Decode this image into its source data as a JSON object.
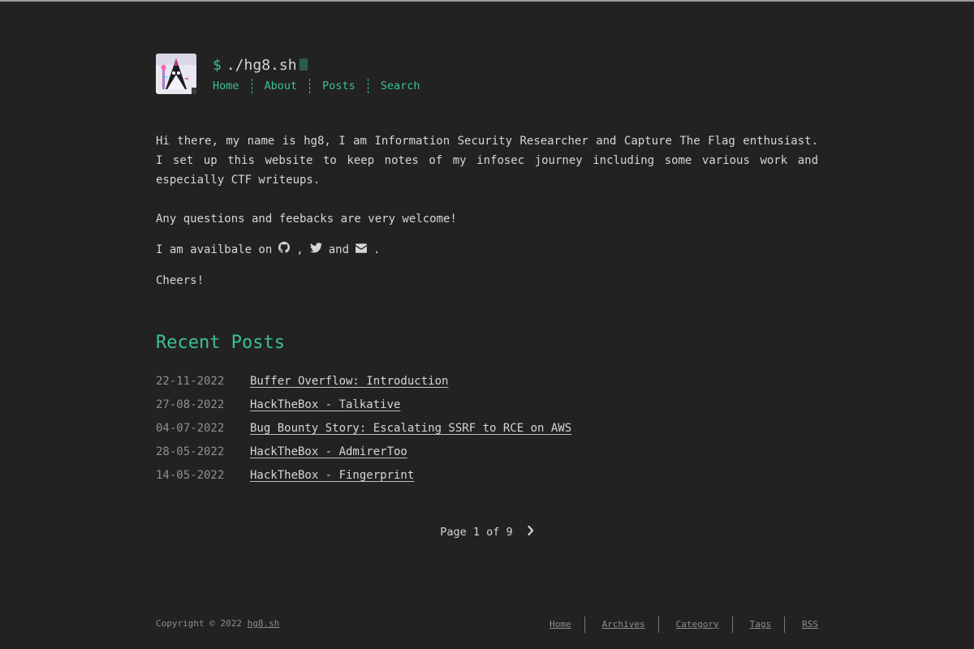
{
  "header": {
    "prompt": "$",
    "title": "./hg8.sh",
    "nav": [
      {
        "label": "Home"
      },
      {
        "label": "About"
      },
      {
        "label": "Posts"
      },
      {
        "label": "Search"
      }
    ]
  },
  "intro": {
    "paragraph1": "Hi there, my name is hg8, I am Information Security Researcher and Capture The Flag enthusiast. I set up this website to keep notes of my infosec journey including some various work and especially CTF writeups.",
    "paragraph2": "Any questions and feebacks are very welcome!",
    "available_prefix": "I am availbale on",
    "comma": ",",
    "and": "and",
    "period": ".",
    "icons": [
      "github-icon",
      "twitter-icon",
      "envelope-icon"
    ],
    "paragraph4": "Cheers!"
  },
  "recent_posts": {
    "title": "Recent Posts",
    "items": [
      {
        "date": "22-11-2022",
        "title": "Buffer Overflow: Introduction"
      },
      {
        "date": "27-08-2022",
        "title": "HackTheBox - Talkative"
      },
      {
        "date": "04-07-2022",
        "title": "Bug Bounty Story: Escalating SSRF to RCE on AWS"
      },
      {
        "date": "28-05-2022",
        "title": "HackTheBox - AdmirerToo"
      },
      {
        "date": "14-05-2022",
        "title": "HackTheBox - Fingerprint"
      }
    ]
  },
  "pagination": {
    "label": "Page 1 of 9",
    "next_icon": "chevron-right-icon"
  },
  "footer": {
    "copyright_prefix": "Copyright © 2022",
    "copyright_link": "hg8.sh",
    "links": [
      {
        "label": "Home"
      },
      {
        "label": "Archives"
      },
      {
        "label": "Category"
      },
      {
        "label": "Tags"
      },
      {
        "label": "RSS"
      }
    ]
  },
  "colors": {
    "background": "#222222",
    "accent": "#3dc08f",
    "text": "#d6d6d6",
    "muted": "#8f8f8f"
  }
}
